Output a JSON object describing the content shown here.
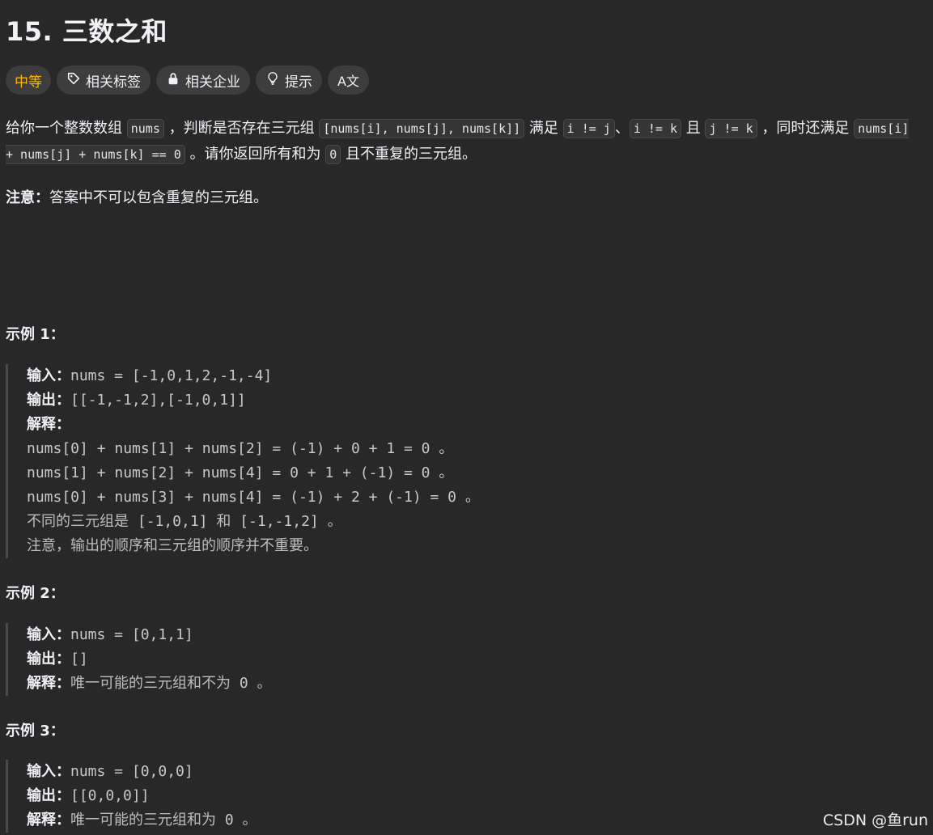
{
  "title": "15. 三数之和",
  "tags": [
    {
      "label": "中等",
      "icon": ""
    },
    {
      "label": "相关标签",
      "icon": "tag-icon"
    },
    {
      "label": "相关企业",
      "icon": "lock-icon"
    },
    {
      "label": "提示",
      "icon": "lightbulb-icon"
    },
    {
      "label": "",
      "icon": "translate-icon",
      "glyph": "A文"
    }
  ],
  "description": {
    "p1_a": "给你一个整数数组",
    "code_nums": "nums",
    "p1_b": "，判断是否存在三元组",
    "code_triple": "[nums[i], nums[j], nums[k]]",
    "p1_c": "满足",
    "code_ij": "i != j",
    "p1_d": "、",
    "code_ik": "i != k",
    "p1_e": "且",
    "code_jk": "j != k",
    "p1_f": "，同时还满足",
    "code_sum": "nums[i] + nums[j] + nums[k] == 0",
    "p1_g": "。请你返回所有和为",
    "code_zero": "0",
    "p1_h": "且不重复的三元组。"
  },
  "note": {
    "label": "注意：",
    "text": "答案中不可以包含重复的三元组。"
  },
  "examples": [
    {
      "title": "示例 1：",
      "input_label": "输入：",
      "input": "nums = [-1,0,1,2,-1,-4]",
      "output_label": "输出：",
      "output": "[[-1,-1,2],[-1,0,1]]",
      "explain_label": "解释：",
      "lines": [
        "nums[0] + nums[1] + nums[2] = (-1) + 0 + 1 = 0 。",
        "nums[1] + nums[2] + nums[4] = 0 + 1 + (-1) = 0 。",
        "nums[0] + nums[3] + nums[4] = (-1) + 2 + (-1) = 0 。"
      ],
      "text_a": "不同的三元组是",
      "mono_a": " [-1,0,1] ",
      "text_b": "和",
      "mono_b": " [-1,-1,2] ",
      "text_c": "。",
      "text_d": "注意，输出的顺序和三元组的顺序并不重要。"
    },
    {
      "title": "示例 2：",
      "input_label": "输入：",
      "input": "nums = [0,1,1]",
      "output_label": "输出：",
      "output": "[]",
      "explain_label": "解释：",
      "explain_a": "唯一可能的三元组和不为",
      "explain_mono": " 0 ",
      "explain_b": "。"
    },
    {
      "title": "示例 3：",
      "input_label": "输入：",
      "input": "nums = [0,0,0]",
      "output_label": "输出：",
      "output": "[[0,0,0]]",
      "explain_label": "解释：",
      "explain_a": "唯一可能的三元组和为",
      "explain_mono": " 0 ",
      "explain_b": "。"
    }
  ],
  "watermark": "CSDN @鱼run",
  "colors": {
    "background": "#282828",
    "difficulty": "#ffb800",
    "tag_bg": "#3d3d3d"
  }
}
